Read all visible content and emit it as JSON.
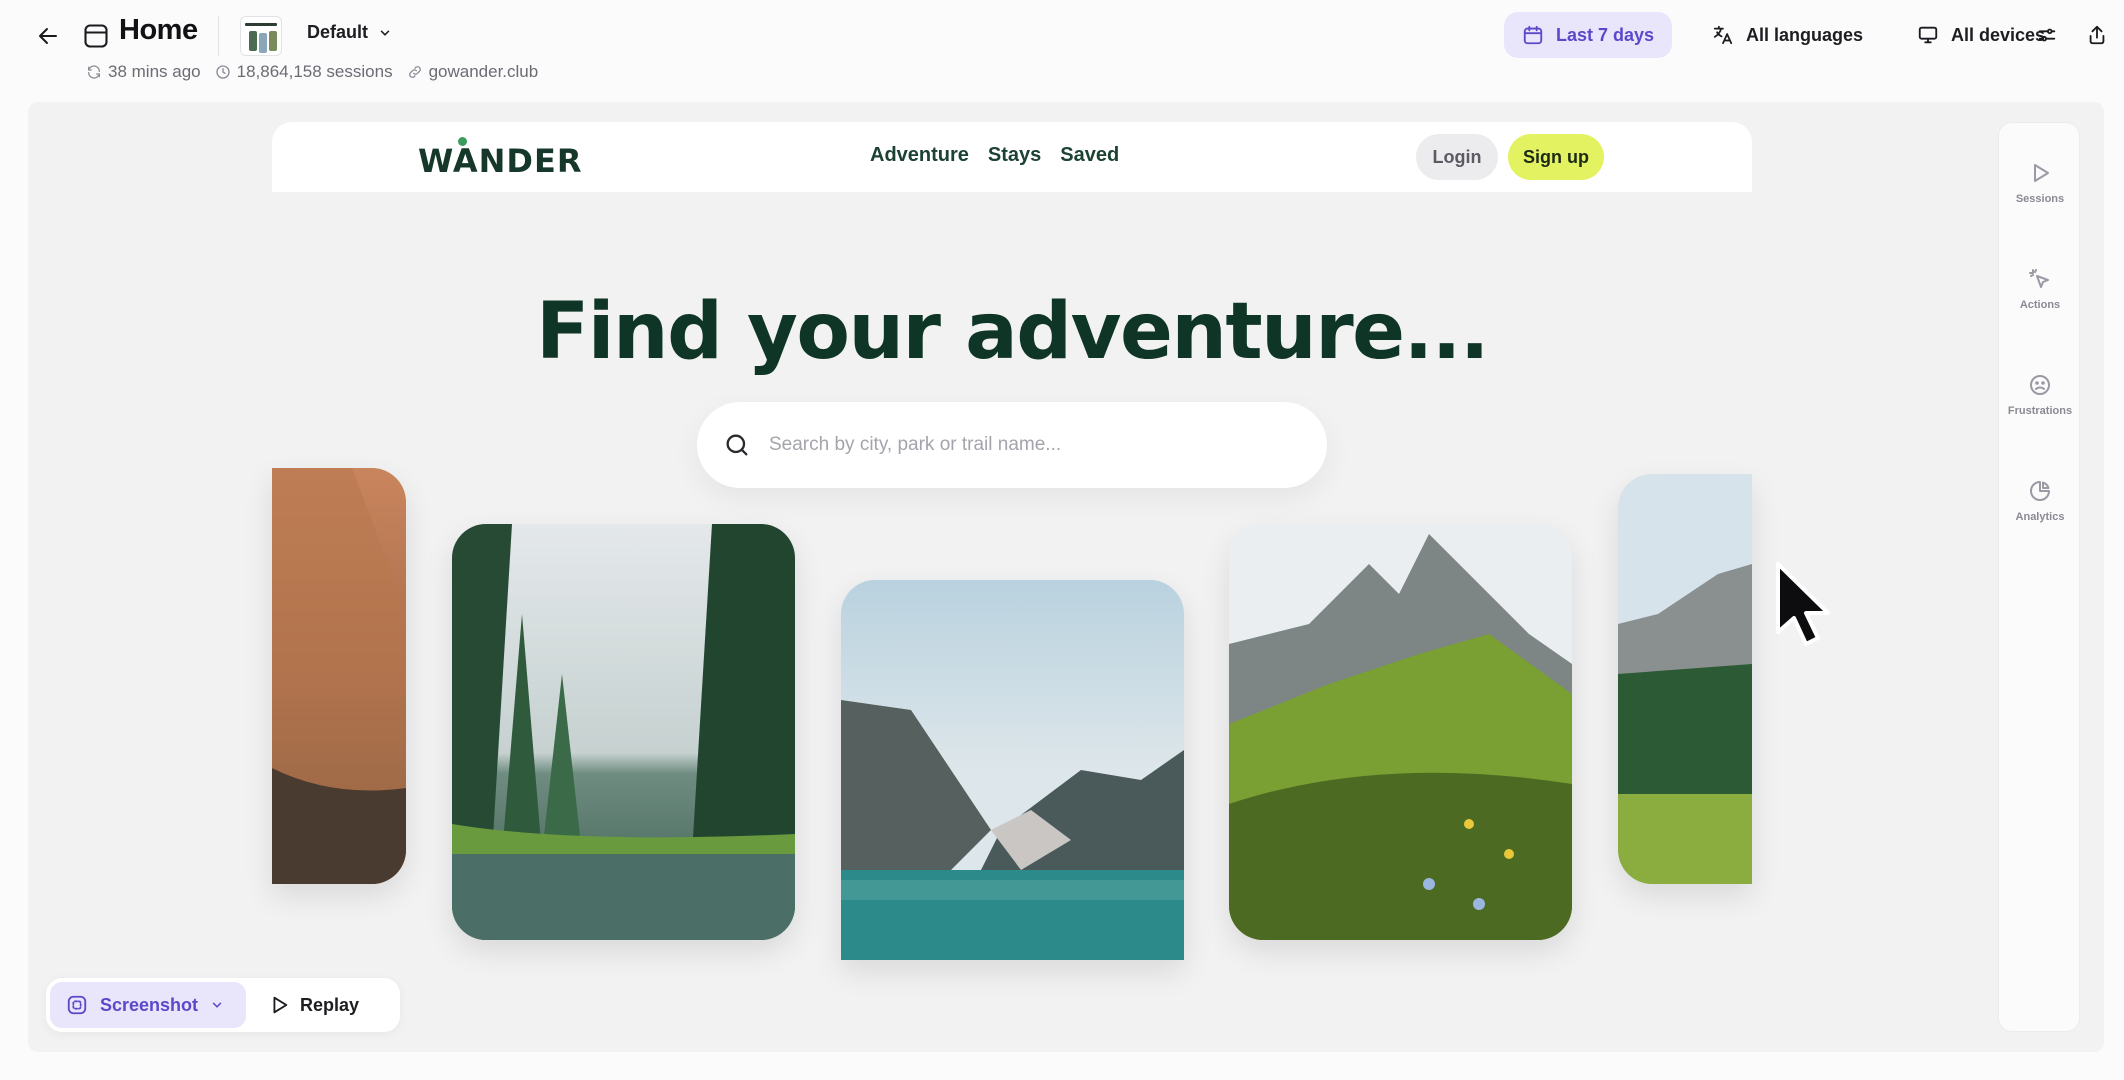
{
  "header": {
    "title": "Home",
    "variant": "Default",
    "meta": {
      "updated": "38 mins ago",
      "sessions": "18,864,158 sessions",
      "domain": "gowander.club"
    },
    "date_range": "Last 7 days",
    "languages": "All languages",
    "devices": "All devices"
  },
  "site": {
    "logo": "WANDER",
    "nav": [
      "Adventure",
      "Stays",
      "Saved"
    ],
    "login": "Login",
    "signup": "Sign up",
    "hero": "Find your adventure...",
    "search_placeholder": "Search by city, park or trail name..."
  },
  "side_panel": {
    "items": [
      {
        "label": "Sessions",
        "icon": "play-icon"
      },
      {
        "label": "Actions",
        "icon": "pointer-click-icon"
      },
      {
        "label": "Frustrations",
        "icon": "frown-icon"
      },
      {
        "label": "Analytics",
        "icon": "pie-chart-icon"
      }
    ]
  },
  "mode": {
    "screenshot": "Screenshot",
    "replay": "Replay"
  },
  "colors": {
    "accent": "#5b49c9",
    "accent_bg": "#e9e5fb",
    "brand_green": "#0f3526",
    "signup": "#e3f261"
  }
}
